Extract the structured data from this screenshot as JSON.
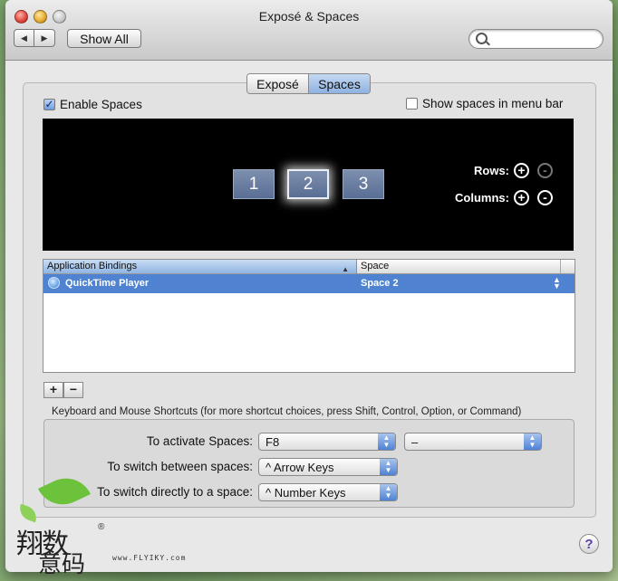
{
  "window": {
    "title": "Exposé & Spaces"
  },
  "toolbar": {
    "back_icon": "◀",
    "forward_icon": "▶",
    "show_all_label": "Show All",
    "search_placeholder": ""
  },
  "tabs": [
    {
      "label": "Exposé",
      "selected": false
    },
    {
      "label": "Spaces",
      "selected": true
    }
  ],
  "options": {
    "enable_spaces_label": "Enable Spaces",
    "enable_spaces_checked": true,
    "menu_bar_label": "Show spaces in menu bar",
    "menu_bar_checked": false
  },
  "spaces": {
    "items": [
      "1",
      "2",
      "3"
    ],
    "selected": "2",
    "rows_label": "Rows:",
    "columns_label": "Columns:",
    "plus_glyph": "+",
    "minus_glyph": "-"
  },
  "bindings": {
    "columns": [
      "Application Bindings",
      "Space"
    ],
    "sort_indicator": "▲",
    "rows": [
      {
        "app": "QuickTime Player",
        "space": "Space 2"
      }
    ],
    "add_label": "+",
    "remove_label": "−"
  },
  "shortcuts": {
    "header": "Keyboard and Mouse Shortcuts (for more shortcut choices, press Shift, Control, Option, or Command)",
    "activate_label": "To activate Spaces:",
    "activate_key": "F8",
    "activate_mouse": "–",
    "switch_label": "To switch between spaces:",
    "switch_value": "^ Arrow Keys",
    "direct_label": "To switch directly to a space:",
    "direct_value": "^ Number Keys"
  },
  "help": {
    "label": "?"
  },
  "watermark": {
    "chars_top": "翔数",
    "chars_bottom": "意码",
    "reg": "®",
    "url": "www.FLYIKY.com"
  },
  "colors": {
    "selection": "#4f83d1",
    "stage": "#000000",
    "accent": "#8eb2e2"
  }
}
